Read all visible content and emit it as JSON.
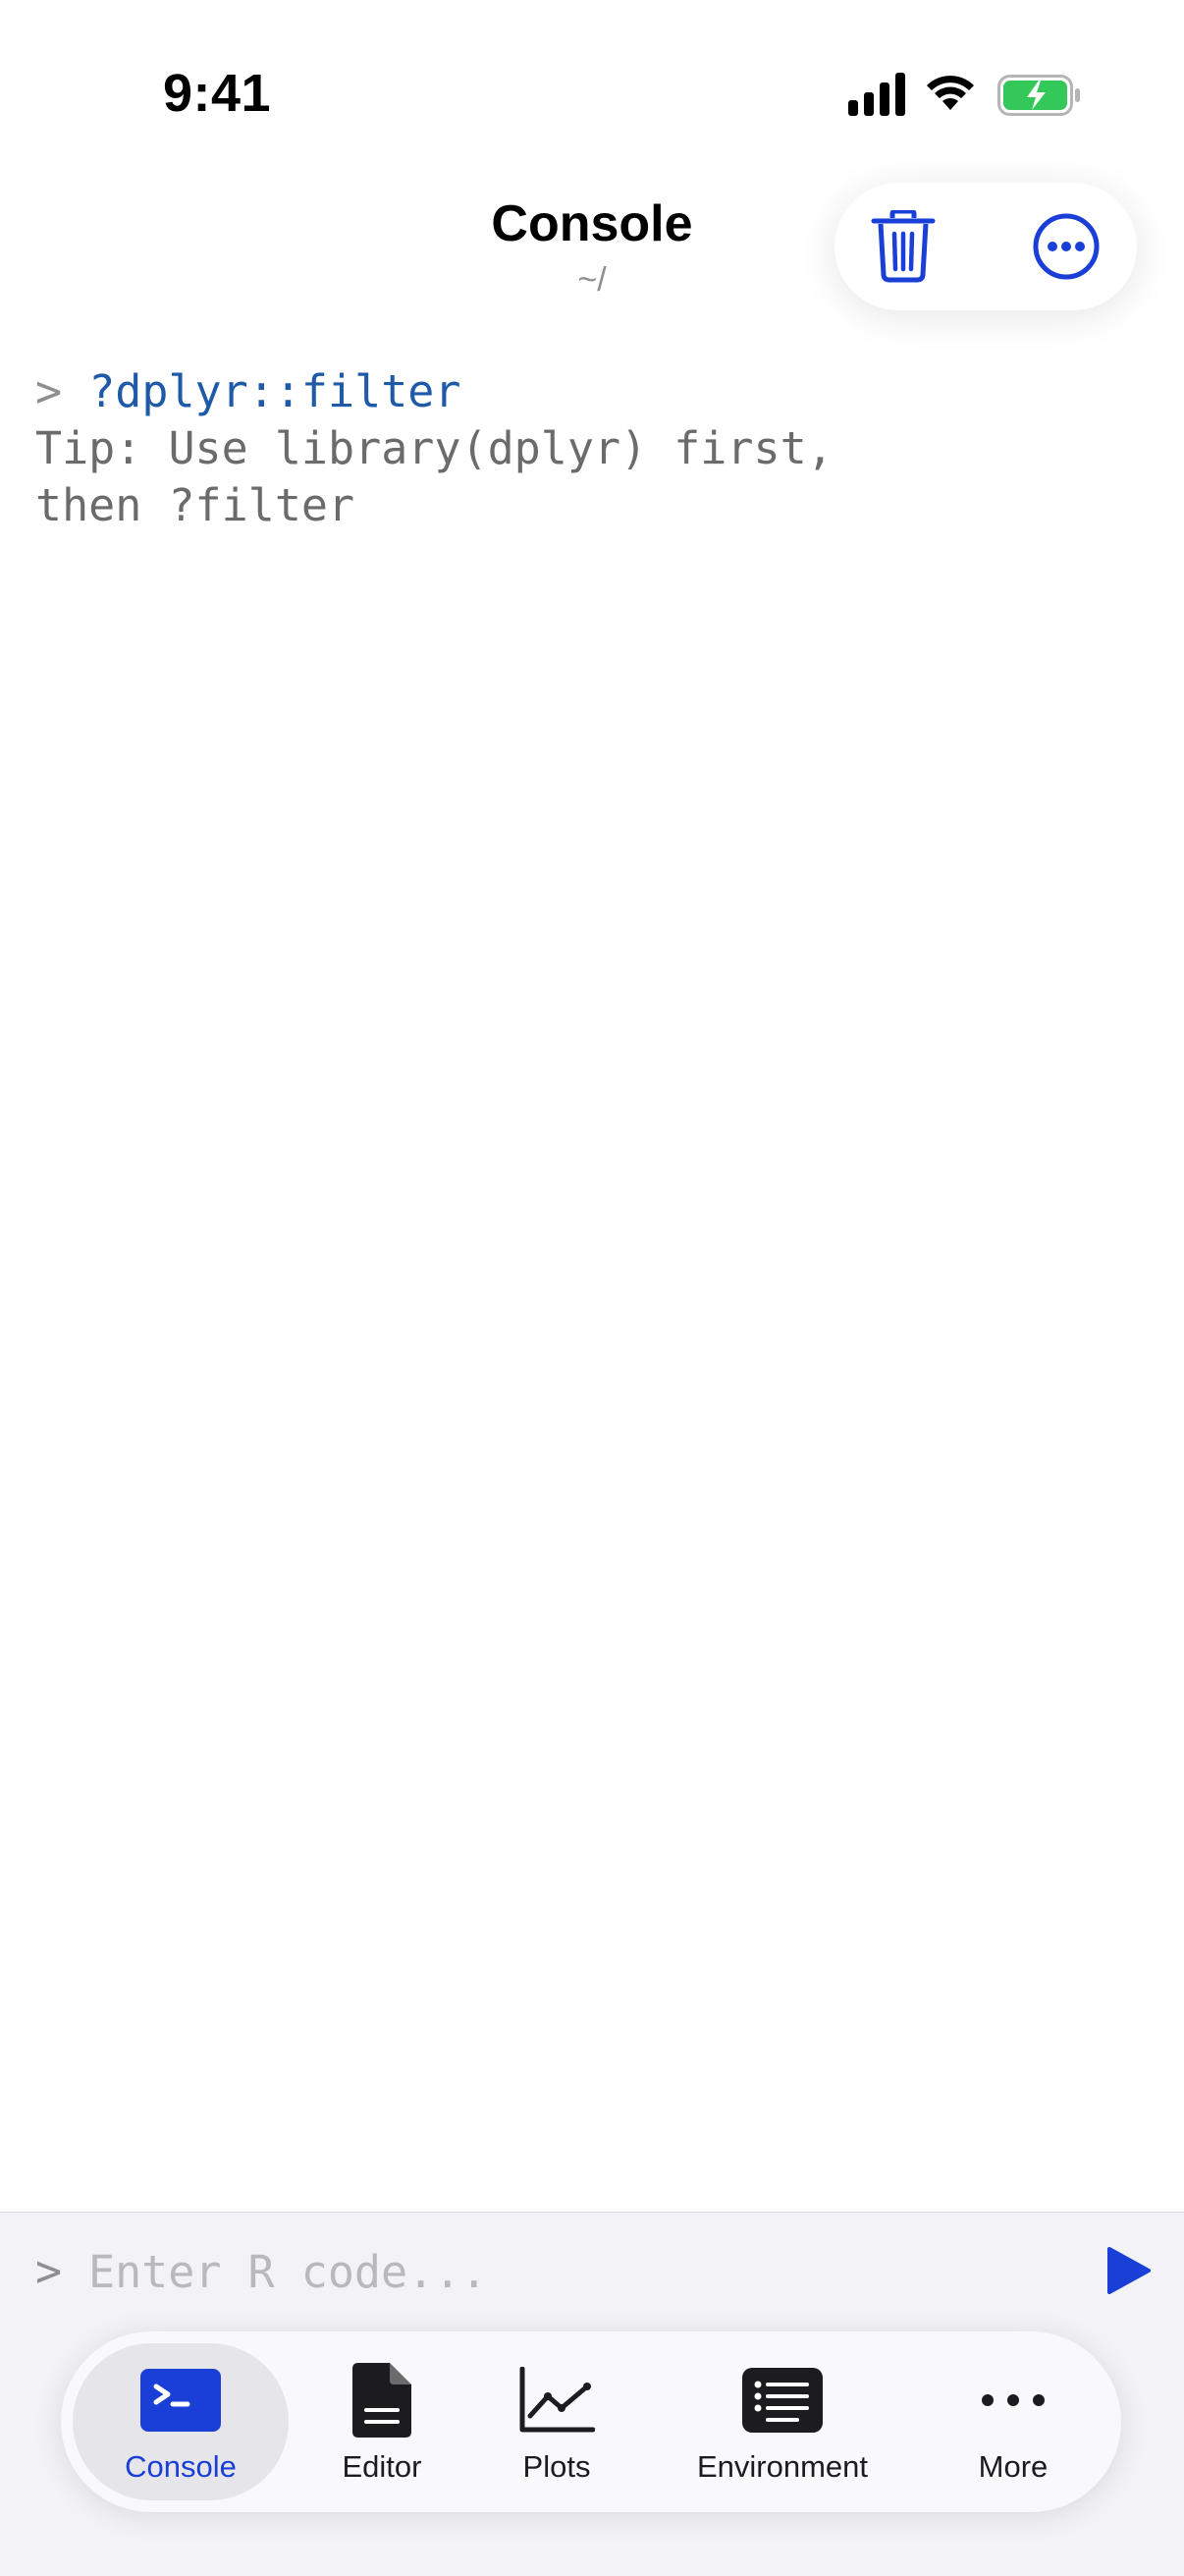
{
  "status_bar": {
    "time": "9:41"
  },
  "nav": {
    "title": "Console",
    "subtitle": "~/"
  },
  "console": {
    "prompt": ">",
    "command": "?dplyr::filter",
    "output": "Tip: Use library(dplyr) first,\nthen ?filter"
  },
  "input": {
    "prompt": ">",
    "placeholder": "Enter R code...",
    "value": ""
  },
  "tabs": [
    {
      "label": "Console",
      "icon": "terminal-icon",
      "active": true
    },
    {
      "label": "Editor",
      "icon": "document-icon",
      "active": false
    },
    {
      "label": "Plots",
      "icon": "line-chart-icon",
      "active": false
    },
    {
      "label": "Environment",
      "icon": "list-icon",
      "active": false
    },
    {
      "label": "More",
      "icon": "ellipsis-icon",
      "active": false
    }
  ],
  "colors": {
    "accent": "#1a3fd6",
    "command": "#1f5aa8",
    "muted": "#8e8e93",
    "battery": "#34c759"
  }
}
